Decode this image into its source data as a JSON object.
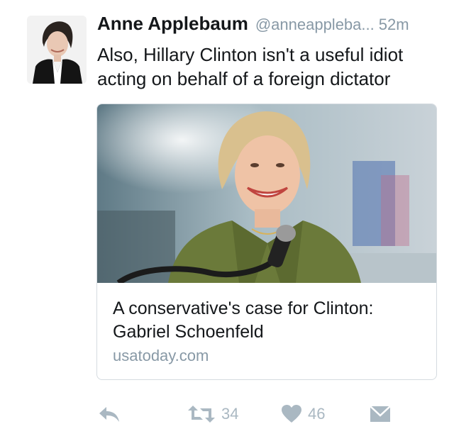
{
  "tweet": {
    "author_name": "Anne Applebaum",
    "handle": "@anneappleba...",
    "time": "52m",
    "text": "Also, Hillary Clinton isn't a useful idiot acting on behalf of a foreign dictator",
    "avatar_icon": "person-photo",
    "card": {
      "title": "A conservative's case for Clinton: Gabriel Schoenfeld",
      "domain": "usatoday.com",
      "image_icon": "photo-woman-smiling-at-microphone"
    },
    "actions": {
      "reply_icon": "reply-arrow-icon",
      "retweet_icon": "retweet-icon",
      "retweet_count": "34",
      "like_icon": "heart-icon",
      "like_count": "46",
      "dm_icon": "envelope-icon"
    },
    "colors": {
      "text": "#14171a",
      "muted": "#8899a6",
      "icon": "#aab8c2",
      "border": "#d5dbe0"
    }
  }
}
